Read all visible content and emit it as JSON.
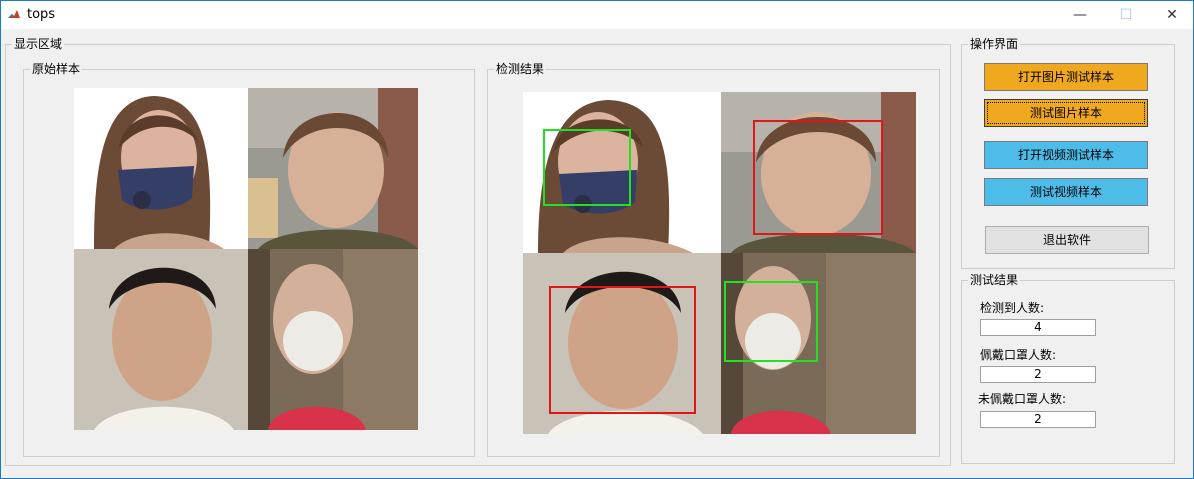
{
  "window": {
    "title": "tops",
    "minimize_icon": "minimize-icon",
    "maximize_icon": "maximize-icon",
    "close_icon": "close-icon"
  },
  "display_area": {
    "title": "显示区域",
    "original": {
      "title": "原始样本"
    },
    "result": {
      "title": "检测结果"
    }
  },
  "controls": {
    "title": "操作界面",
    "buttons": {
      "open_image": "打开图片测试样本",
      "test_image": "测试图片样本",
      "open_video": "打开视频测试样本",
      "test_video": "测试视频样本",
      "exit": "退出软件"
    }
  },
  "results": {
    "title": "测试结果",
    "detected_label": "检测到人数:",
    "detected_value": "4",
    "masked_label": "佩戴口罩人数:",
    "masked_value": "2",
    "unmasked_label": "未佩戴口罩人数:",
    "unmasked_value": "2"
  },
  "colors": {
    "button_orange": "#f0a81e",
    "button_blue": "#4dbce9",
    "mask_box": "#22e022",
    "no_mask_box": "#e0161a",
    "title_border": "#1979ca"
  }
}
